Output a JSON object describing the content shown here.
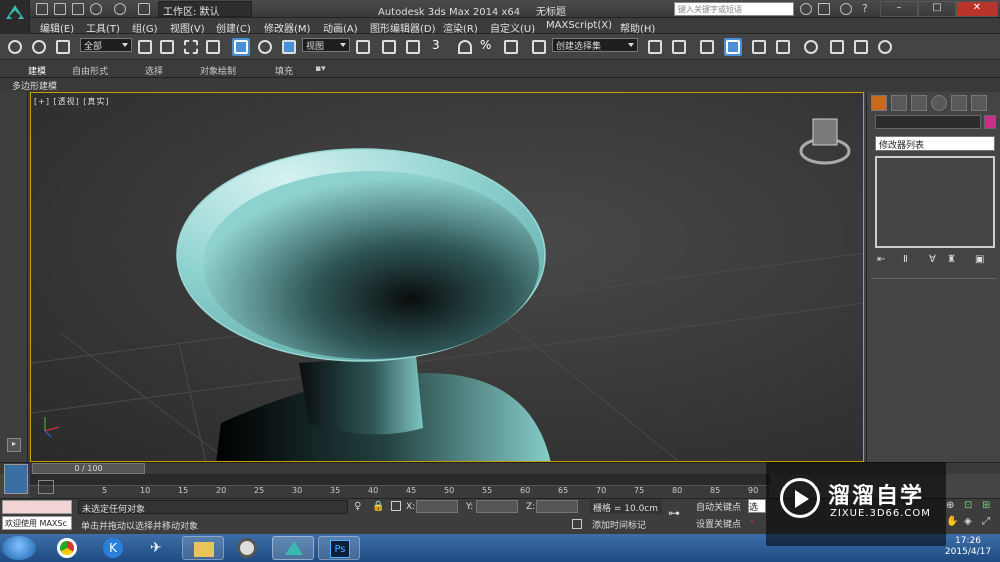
{
  "title_bar": {
    "workspace": "工作区: 默认",
    "app_title": "Autodesk 3ds Max  2014 x64",
    "file_title": "无标题",
    "search_placeholder": "键入关键字或短语"
  },
  "menu": [
    "编辑(E)",
    "工具(T)",
    "组(G)",
    "视图(V)",
    "创建(C)",
    "修改器(M)",
    "动画(A)",
    "图形编辑器(D)",
    "渲染(R)",
    "自定义(U)",
    "MAXScript(X)",
    "帮助(H)"
  ],
  "toolbar": {
    "selection_filter": "全部",
    "ref_coord": "视图",
    "snap_value": "3",
    "percent_snap": "%",
    "named_selection": "创建选择集"
  },
  "ribbon": {
    "tabs": [
      "建模",
      "自由形式",
      "选择",
      "对象绘制",
      "填充"
    ],
    "active_tab": "建模",
    "subpanel": "多边形建模"
  },
  "viewport": {
    "label": "[+] [透视] [真实]"
  },
  "command_panel": {
    "modifier_list": "修改器列表"
  },
  "timeline": {
    "slider": "0 / 100",
    "ticks": [
      "5",
      "10",
      "15",
      "20",
      "25",
      "30",
      "35",
      "40",
      "45",
      "50",
      "55",
      "60",
      "65",
      "70",
      "75",
      "80",
      "85",
      "90"
    ]
  },
  "status": {
    "welcome": "欢迎使用 MAXSc",
    "selection": "未选定任何对象",
    "prompt": "单击并拖动以选择并移动对象",
    "x_label": "X:",
    "y_label": "Y:",
    "z_label": "Z:",
    "grid": "栅格 = 10.0cm",
    "add_time_tag": "添加时间标记",
    "auto_key": "自动关键点",
    "set_key": "设置关键点",
    "key_filter_value": "选定"
  },
  "taskbar": {
    "time": "17:26",
    "date": "2015/4/17"
  },
  "watermark": {
    "title": "溜溜自学",
    "url": "ZIXUE.3D66.COM"
  }
}
